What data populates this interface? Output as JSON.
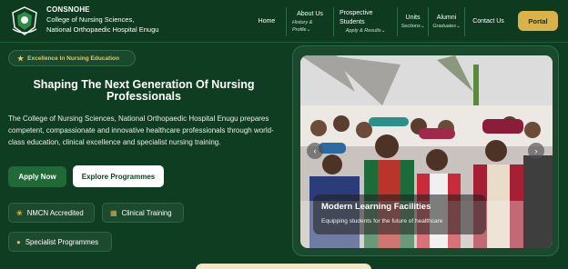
{
  "header": {
    "brand_name": "CONSNOHE",
    "brand_line1": "College of Nursing Sciences,",
    "brand_line2": "National Orthopaedic Hospital Enugu",
    "portal_label": "Portal"
  },
  "nav": [
    {
      "label": "Home",
      "sub": ""
    },
    {
      "label": "About Us",
      "sub": "History & Profile⌄"
    },
    {
      "label": "Prospective Students",
      "sub": "Apply & Results⌄"
    },
    {
      "label": "Units",
      "sub": "Sections⌄"
    },
    {
      "label": "Alumni",
      "sub": "Graduates⌄"
    },
    {
      "label": "Contact Us",
      "sub": ""
    }
  ],
  "hero": {
    "badge": "Excellence In Nursing Education",
    "title": "Shaping The Next Generation Of Nursing Professionals",
    "description": "The College of Nursing Sciences, National Orthopaedic Hospital Enugu prepares competent, compassionate and innovative healthcare professionals through world-class education, clinical excellence and specialist nursing training.",
    "apply_label": "Apply Now",
    "explore_label": "Explore Programmes"
  },
  "features": [
    {
      "label": "NMCN Accredited",
      "icon": "award-icon"
    },
    {
      "label": "Clinical Training",
      "icon": "clinic-icon"
    },
    {
      "label": "Specialist Programmes",
      "icon": "user-icon"
    }
  ],
  "carousel": {
    "caption_title": "Modern Learning Facilities",
    "caption_subtitle": "Equipping students for the future of healthcare",
    "prev_icon": "chevron-left-icon",
    "next_icon": "chevron-right-icon"
  },
  "colors": {
    "background": "#0f3d22",
    "accent_gold": "#d9b24a",
    "primary_green": "#1f6a36"
  }
}
